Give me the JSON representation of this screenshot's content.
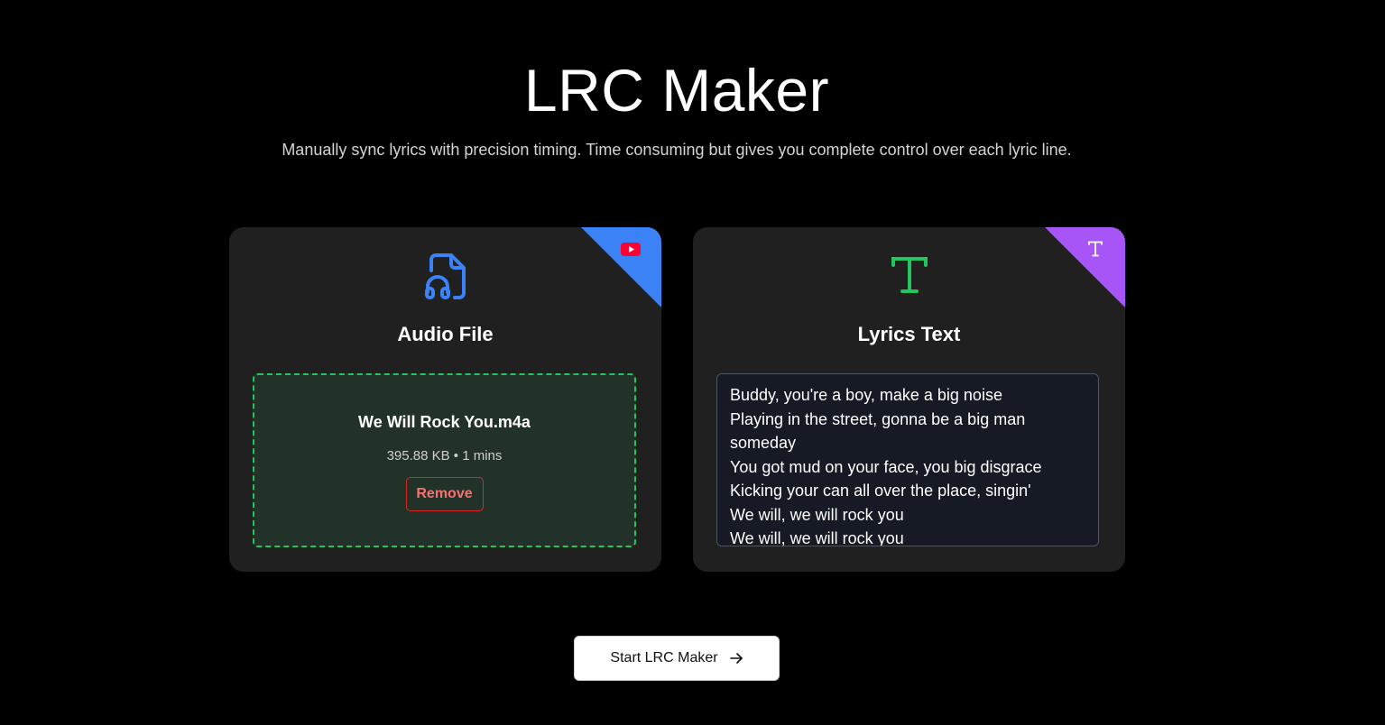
{
  "header": {
    "title": "LRC Maker",
    "subtitle": "Manually sync lyrics with precision timing. Time consuming but gives you complete control over each lyric line."
  },
  "audio_card": {
    "title": "Audio File",
    "icon": "file-audio-icon",
    "corner_icon": "youtube-icon",
    "accent_color": "#3b82f6",
    "file": {
      "name": "We Will Rock You.m4a",
      "meta": "395.88 KB • 1 mins"
    },
    "remove_label": "Remove"
  },
  "lyrics_card": {
    "title": "Lyrics Text",
    "icon": "text-icon",
    "corner_icon": "text-icon",
    "accent_color": "#a855f7",
    "lines": [
      "Buddy, you're a boy, make a big noise",
      "Playing in the street, gonna be a big man",
      "someday",
      "You got mud on your face, you big disgrace",
      "Kicking your can all over the place, singin'",
      "We will, we will rock you",
      "We will, we will rock you"
    ]
  },
  "start_button": {
    "label": "Start LRC Maker",
    "icon": "arrow-right-icon"
  }
}
